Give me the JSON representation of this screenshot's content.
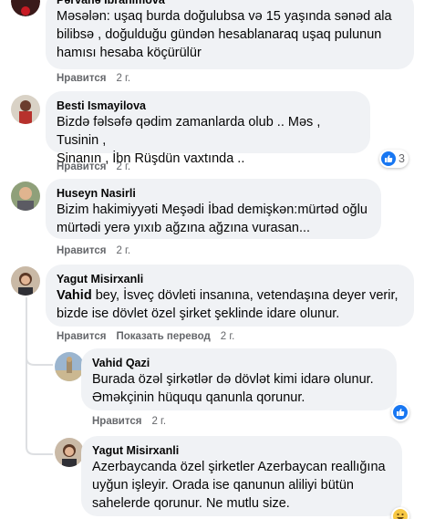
{
  "comments": [
    {
      "author": "Pərvanə İbrahimova",
      "lines": [
        "Məsələn: uşaq burda doğulubsa və 15 yaşında sənəd ala",
        "bilibsə , doğulduğu gündən hesablanaraq uşaq pulunun",
        "hamısı hesaba köçürülür"
      ],
      "like_label": "Нравится",
      "time": "2 г."
    },
    {
      "author": "Besti Ismayilova",
      "lines": [
        "Bizdə fəlsəfə qədim zamanlarda olub .. Məs , Tusinin ,",
        "Sinanın , İbn Rüşdün vaxtında .."
      ],
      "like_label": "Нравится",
      "time": "2 г.",
      "reaction_count": "3"
    },
    {
      "author": "Huseyn Nasirli",
      "lines": [
        "Bizim hakimiyyəti Meşədi İbad demişkən:mürtəd oğlu",
        "mürtədi yerə yıxıb ağzına ağzına vurasan..."
      ],
      "like_label": "Нравится",
      "time": "2 г."
    },
    {
      "author": "Yagut Misirxanli",
      "mention": "Vahid",
      "line1_rest": " bey, İsveç dövleti insanına, vetendaşına deyer verir,",
      "lines_rest": [
        "bizde ise dövlet özel şirket şeklinde idare olunur."
      ],
      "like_label": "Нравится",
      "translate_label": "Показать перевод",
      "time": "2 г."
    }
  ],
  "replies": [
    {
      "author": "Vahid Qazi",
      "lines": [
        "Burada özəl şirkətlər də dövlət kimi idarə olunur.",
        "Əməkçinin hüququ qanunla qorunur."
      ],
      "like_label": "Нравится",
      "time": "2 г."
    },
    {
      "author": "Yagut Misirxanli",
      "lines": [
        "Azerbaycanda özel şirketler Azerbaycan reallığına",
        "uyğun işleyir. Orada ise qanunun aliliyi bütün",
        "sahelerde qorunur. Ne mutlu size."
      ]
    }
  ],
  "colors": {
    "bubble": "#f0f2f5",
    "meta": "#65676b",
    "like_blue": "#1877f2",
    "haha_yellow": "#f7c844"
  },
  "icons": [
    "like-icon",
    "haha-icon"
  ]
}
